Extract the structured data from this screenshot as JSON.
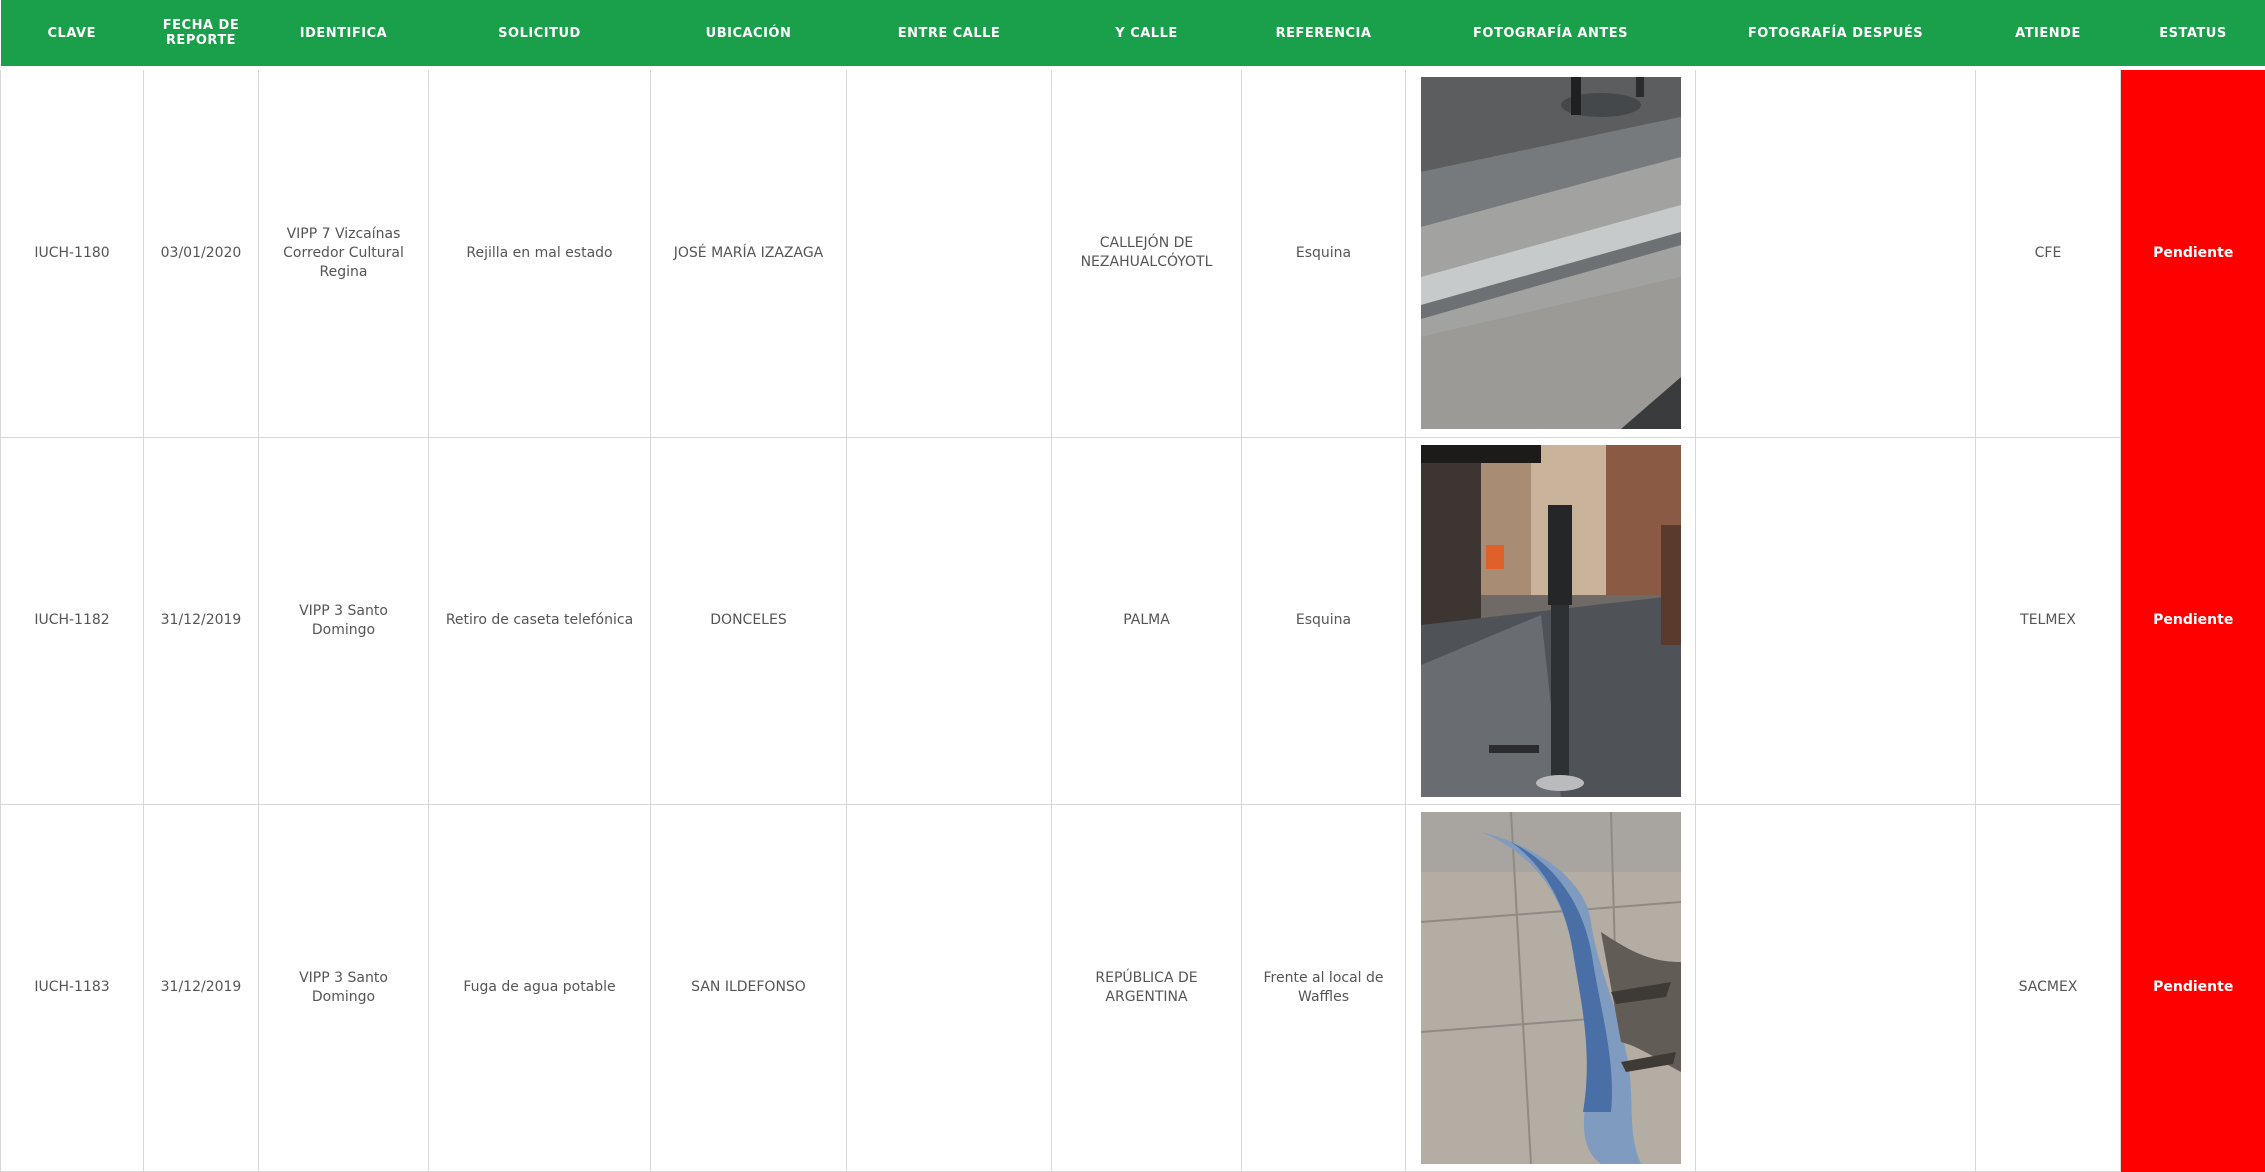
{
  "header": {
    "clave": "CLAVE",
    "fecha": "FECHA DE REPORTE",
    "identifica": "IDENTIFICA",
    "solicitud": "SOLICITUD",
    "ubicacion": "UBICACIÓN",
    "entre_calle": "ENTRE CALLE",
    "y_calle": "Y CALLE",
    "referencia": "REFERENCIA",
    "foto_antes": "FOTOGRAFÍA ANTES",
    "foto_despues": "FOTOGRAFÍA DESPUÉS",
    "atiende": "ATIENDE",
    "estatus": "ESTATUS"
  },
  "rows": [
    {
      "clave": "IUCH-1180",
      "fecha": "03/01/2020",
      "identifica": "VIPP 7 Vizcaínas Corredor Cultural Regina",
      "solicitud": "Rejilla en mal estado",
      "ubicacion": "JOSÉ MARÍA IZAZAGA",
      "entre_calle": "",
      "y_calle": "CALLEJÓN DE NEZAHUALCÓYOTL",
      "referencia": "Esquina",
      "foto_despues": "",
      "atiende": "CFE",
      "estatus": "Pendiente",
      "photo_icon": "photo-sidewalk-grate"
    },
    {
      "clave": "IUCH-1182",
      "fecha": "31/12/2019",
      "identifica": "VIPP 3 Santo Domingo",
      "solicitud": "Retiro de caseta telefónica",
      "ubicacion": "DONCELES",
      "entre_calle": "",
      "y_calle": "PALMA",
      "referencia": "Esquina",
      "foto_despues": "",
      "atiende": "TELMEX",
      "estatus": "Pendiente",
      "photo_icon": "photo-street-post"
    },
    {
      "clave": "IUCH-1183",
      "fecha": "31/12/2019",
      "identifica": "VIPP 3 Santo Domingo",
      "solicitud": "Fuga de agua potable",
      "ubicacion": "SAN ILDEFONSO",
      "entre_calle": "",
      "y_calle": "REPÚBLICA DE ARGENTINA",
      "referencia": "Frente al local de Waffles",
      "foto_despues": "",
      "atiende": "SACMEX",
      "estatus": "Pendiente",
      "photo_icon": "photo-water-leak"
    }
  ],
  "colors": {
    "header_green": "#1aa04a",
    "status_red": "#ff0000",
    "grid": "#d7d7d7"
  }
}
